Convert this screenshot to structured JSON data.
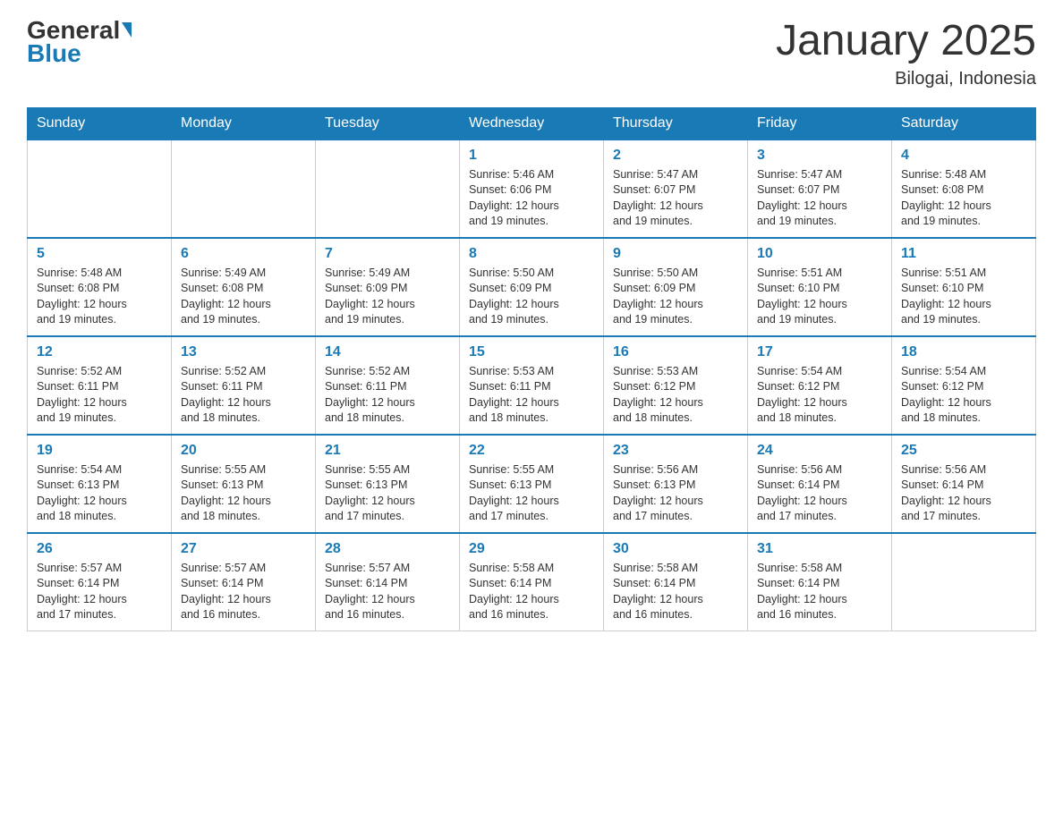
{
  "header": {
    "logo_general": "General",
    "logo_blue": "Blue",
    "month_title": "January 2025",
    "location": "Bilogai, Indonesia"
  },
  "weekdays": [
    "Sunday",
    "Monday",
    "Tuesday",
    "Wednesday",
    "Thursday",
    "Friday",
    "Saturday"
  ],
  "weeks": [
    [
      {
        "day": "",
        "info": ""
      },
      {
        "day": "",
        "info": ""
      },
      {
        "day": "",
        "info": ""
      },
      {
        "day": "1",
        "info": "Sunrise: 5:46 AM\nSunset: 6:06 PM\nDaylight: 12 hours\nand 19 minutes."
      },
      {
        "day": "2",
        "info": "Sunrise: 5:47 AM\nSunset: 6:07 PM\nDaylight: 12 hours\nand 19 minutes."
      },
      {
        "day": "3",
        "info": "Sunrise: 5:47 AM\nSunset: 6:07 PM\nDaylight: 12 hours\nand 19 minutes."
      },
      {
        "day": "4",
        "info": "Sunrise: 5:48 AM\nSunset: 6:08 PM\nDaylight: 12 hours\nand 19 minutes."
      }
    ],
    [
      {
        "day": "5",
        "info": "Sunrise: 5:48 AM\nSunset: 6:08 PM\nDaylight: 12 hours\nand 19 minutes."
      },
      {
        "day": "6",
        "info": "Sunrise: 5:49 AM\nSunset: 6:08 PM\nDaylight: 12 hours\nand 19 minutes."
      },
      {
        "day": "7",
        "info": "Sunrise: 5:49 AM\nSunset: 6:09 PM\nDaylight: 12 hours\nand 19 minutes."
      },
      {
        "day": "8",
        "info": "Sunrise: 5:50 AM\nSunset: 6:09 PM\nDaylight: 12 hours\nand 19 minutes."
      },
      {
        "day": "9",
        "info": "Sunrise: 5:50 AM\nSunset: 6:09 PM\nDaylight: 12 hours\nand 19 minutes."
      },
      {
        "day": "10",
        "info": "Sunrise: 5:51 AM\nSunset: 6:10 PM\nDaylight: 12 hours\nand 19 minutes."
      },
      {
        "day": "11",
        "info": "Sunrise: 5:51 AM\nSunset: 6:10 PM\nDaylight: 12 hours\nand 19 minutes."
      }
    ],
    [
      {
        "day": "12",
        "info": "Sunrise: 5:52 AM\nSunset: 6:11 PM\nDaylight: 12 hours\nand 19 minutes."
      },
      {
        "day": "13",
        "info": "Sunrise: 5:52 AM\nSunset: 6:11 PM\nDaylight: 12 hours\nand 18 minutes."
      },
      {
        "day": "14",
        "info": "Sunrise: 5:52 AM\nSunset: 6:11 PM\nDaylight: 12 hours\nand 18 minutes."
      },
      {
        "day": "15",
        "info": "Sunrise: 5:53 AM\nSunset: 6:11 PM\nDaylight: 12 hours\nand 18 minutes."
      },
      {
        "day": "16",
        "info": "Sunrise: 5:53 AM\nSunset: 6:12 PM\nDaylight: 12 hours\nand 18 minutes."
      },
      {
        "day": "17",
        "info": "Sunrise: 5:54 AM\nSunset: 6:12 PM\nDaylight: 12 hours\nand 18 minutes."
      },
      {
        "day": "18",
        "info": "Sunrise: 5:54 AM\nSunset: 6:12 PM\nDaylight: 12 hours\nand 18 minutes."
      }
    ],
    [
      {
        "day": "19",
        "info": "Sunrise: 5:54 AM\nSunset: 6:13 PM\nDaylight: 12 hours\nand 18 minutes."
      },
      {
        "day": "20",
        "info": "Sunrise: 5:55 AM\nSunset: 6:13 PM\nDaylight: 12 hours\nand 18 minutes."
      },
      {
        "day": "21",
        "info": "Sunrise: 5:55 AM\nSunset: 6:13 PM\nDaylight: 12 hours\nand 17 minutes."
      },
      {
        "day": "22",
        "info": "Sunrise: 5:55 AM\nSunset: 6:13 PM\nDaylight: 12 hours\nand 17 minutes."
      },
      {
        "day": "23",
        "info": "Sunrise: 5:56 AM\nSunset: 6:13 PM\nDaylight: 12 hours\nand 17 minutes."
      },
      {
        "day": "24",
        "info": "Sunrise: 5:56 AM\nSunset: 6:14 PM\nDaylight: 12 hours\nand 17 minutes."
      },
      {
        "day": "25",
        "info": "Sunrise: 5:56 AM\nSunset: 6:14 PM\nDaylight: 12 hours\nand 17 minutes."
      }
    ],
    [
      {
        "day": "26",
        "info": "Sunrise: 5:57 AM\nSunset: 6:14 PM\nDaylight: 12 hours\nand 17 minutes."
      },
      {
        "day": "27",
        "info": "Sunrise: 5:57 AM\nSunset: 6:14 PM\nDaylight: 12 hours\nand 16 minutes."
      },
      {
        "day": "28",
        "info": "Sunrise: 5:57 AM\nSunset: 6:14 PM\nDaylight: 12 hours\nand 16 minutes."
      },
      {
        "day": "29",
        "info": "Sunrise: 5:58 AM\nSunset: 6:14 PM\nDaylight: 12 hours\nand 16 minutes."
      },
      {
        "day": "30",
        "info": "Sunrise: 5:58 AM\nSunset: 6:14 PM\nDaylight: 12 hours\nand 16 minutes."
      },
      {
        "day": "31",
        "info": "Sunrise: 5:58 AM\nSunset: 6:14 PM\nDaylight: 12 hours\nand 16 minutes."
      },
      {
        "day": "",
        "info": ""
      }
    ]
  ]
}
